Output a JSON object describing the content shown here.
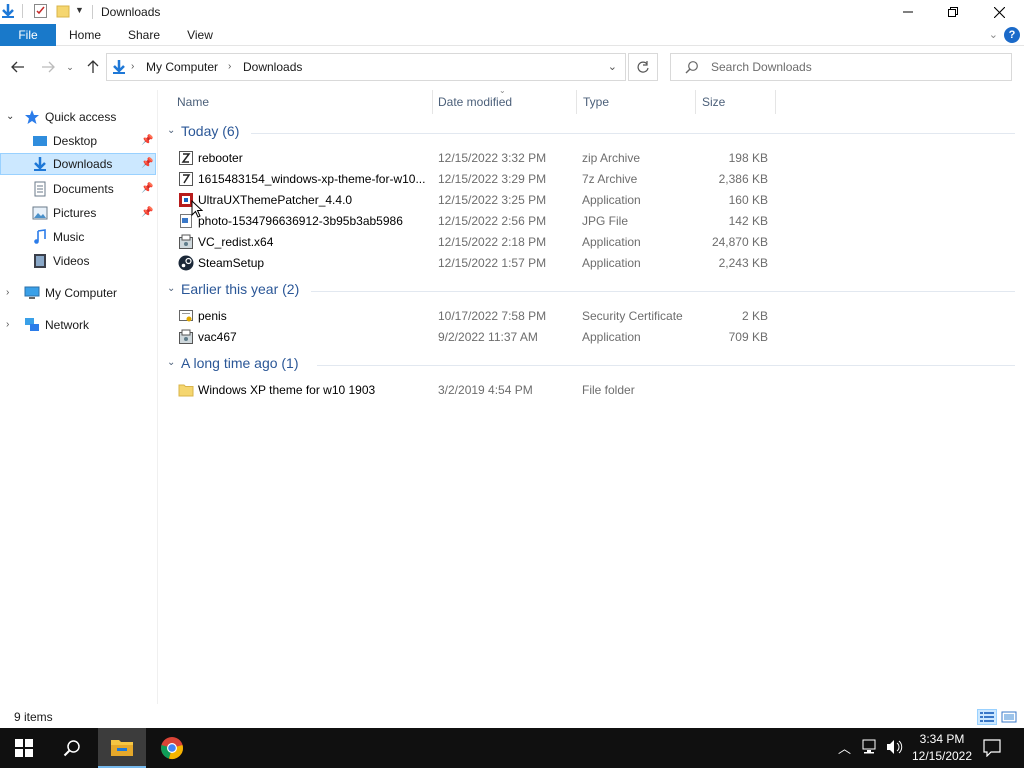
{
  "window": {
    "title": "Downloads"
  },
  "ribbon": {
    "tabs": [
      "File",
      "Home",
      "Share",
      "View"
    ],
    "help": "?"
  },
  "address": {
    "breadcrumbs": [
      "My Computer",
      "Downloads"
    ],
    "search_placeholder": "Search Downloads"
  },
  "sidebar": {
    "quick_access": "Quick access",
    "items": [
      {
        "label": "Desktop",
        "pinned": true
      },
      {
        "label": "Downloads",
        "pinned": true,
        "selected": true
      },
      {
        "label": "Documents",
        "pinned": true
      },
      {
        "label": "Pictures",
        "pinned": true
      },
      {
        "label": "Music",
        "pinned": false
      },
      {
        "label": "Videos",
        "pinned": false
      }
    ],
    "my_computer": "My Computer",
    "network": "Network"
  },
  "columns": {
    "name": "Name",
    "date": "Date modified",
    "type": "Type",
    "size": "Size"
  },
  "groups": [
    {
      "title": "Today (6)",
      "files": [
        {
          "name": "rebooter",
          "date": "12/15/2022 3:32 PM",
          "type": "zip Archive",
          "size": "198 KB",
          "icon": "archive-icon"
        },
        {
          "name": "1615483154_windows-xp-theme-for-w10...",
          "date": "12/15/2022 3:29 PM",
          "type": "7z Archive",
          "size": "2,386 KB",
          "icon": "archive-icon"
        },
        {
          "name": "UltraUXThemePatcher_4.4.0",
          "date": "12/15/2022 3:25 PM",
          "type": "Application",
          "size": "160 KB",
          "icon": "patcher-icon"
        },
        {
          "name": "photo-1534796636912-3b95b3ab5986",
          "date": "12/15/2022 2:56 PM",
          "type": "JPG File",
          "size": "142 KB",
          "icon": "image-file-icon"
        },
        {
          "name": "VC_redist.x64",
          "date": "12/15/2022 2:18 PM",
          "type": "Application",
          "size": "24,870 KB",
          "icon": "installer-icon"
        },
        {
          "name": "SteamSetup",
          "date": "12/15/2022 1:57 PM",
          "type": "Application",
          "size": "2,243 KB",
          "icon": "steam-icon"
        }
      ]
    },
    {
      "title": "Earlier this year (2)",
      "files": [
        {
          "name": "penis",
          "date": "10/17/2022 7:58 PM",
          "type": "Security Certificate",
          "size": "2 KB",
          "icon": "certificate-icon"
        },
        {
          "name": "vac467",
          "date": "9/2/2022 11:37 AM",
          "type": "Application",
          "size": "709 KB",
          "icon": "installer-icon"
        }
      ]
    },
    {
      "title": "A long time ago (1)",
      "files": [
        {
          "name": "Windows XP theme for w10 1903",
          "date": "3/2/2019 4:54 PM",
          "type": "File folder",
          "size": "",
          "icon": "folder-icon"
        }
      ]
    }
  ],
  "status": {
    "items": "9 items"
  },
  "taskbar": {
    "time": "3:34 PM",
    "date": "12/15/2022"
  }
}
